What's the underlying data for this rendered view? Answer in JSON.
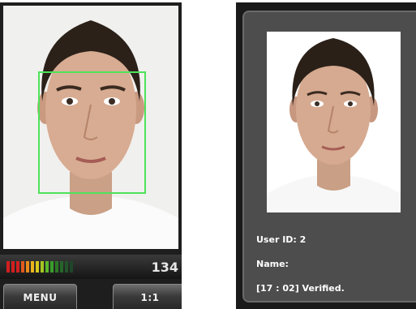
{
  "left_screen": {
    "counter_text": "134",
    "signal_colors": [
      "#d21f1f",
      "#d21f1f",
      "#d21f1f",
      "#e05a1c",
      "#e88a1a",
      "#e9b41b",
      "#d7c91d",
      "#a6c520",
      "#5bb82a",
      "#3a9d2a",
      "#2b7a25",
      "#25662a",
      "#22552a",
      "#1f462a"
    ],
    "face_box_color": "#4ee35a",
    "buttons": {
      "menu_label": "MENU",
      "one_to_one_label": "1:1"
    }
  },
  "right_screen": {
    "user_id_text": "User ID: 2",
    "name_text": "Name:",
    "status_text": "[17 : 02] Verified."
  }
}
